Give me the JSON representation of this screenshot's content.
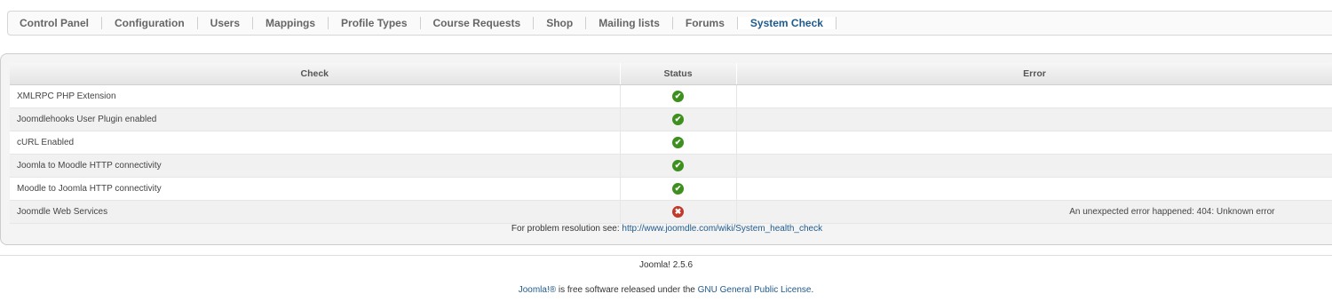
{
  "menu": {
    "items": [
      "Control Panel",
      "Configuration",
      "Users",
      "Mappings",
      "Profile Types",
      "Course Requests",
      "Shop",
      "Mailing lists",
      "Forums",
      "System Check"
    ],
    "active": "System Check"
  },
  "table": {
    "headers": {
      "check": "Check",
      "status": "Status",
      "error": "Error"
    },
    "rows": [
      {
        "name": "XMLRPC PHP Extension",
        "status": "ok",
        "error": ""
      },
      {
        "name": "Joomdlehooks User Plugin enabled",
        "status": "ok",
        "error": ""
      },
      {
        "name": "cURL Enabled",
        "status": "ok",
        "error": ""
      },
      {
        "name": "Joomla to Moodle HTTP connectivity",
        "status": "ok",
        "error": ""
      },
      {
        "name": "Moodle to Joomla HTTP connectivity",
        "status": "ok",
        "error": ""
      },
      {
        "name": "Joomdle Web Services",
        "status": "error",
        "error": "An unexpected error happened: 404: Unknown error"
      }
    ],
    "status_icons": {
      "ok": "check-circle-icon",
      "error": "error-circle-icon"
    },
    "status_colors": {
      "ok": "#3d8f1e",
      "error": "#c0392b"
    }
  },
  "resolution": {
    "text": "For problem resolution see:",
    "link": "http://www.joomdle.com/wiki/System_health_check"
  },
  "footer": {
    "version": "Joomla! 2.5.6",
    "joomla_link": "Joomla!®",
    "license_middle": " is free software released under the ",
    "license_link": "GNU General Public License",
    "license_end": "."
  },
  "colors": {
    "link": "#1f5a8c",
    "active_tab": "#1f5a8c"
  }
}
